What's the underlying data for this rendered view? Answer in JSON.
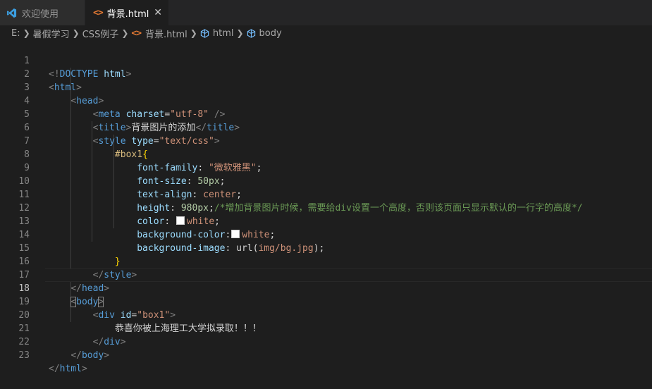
{
  "tabs": [
    {
      "label": "欢迎使用",
      "icon": "vscode-logo-icon"
    },
    {
      "label": "背景.html",
      "icon": "html-file-icon",
      "close": "✕"
    }
  ],
  "breadcrumb": {
    "drive": "E:",
    "folder1": "暑假学习",
    "folder2": "CSS例子",
    "file": "背景.html",
    "symbol1": "html",
    "symbol2": "body"
  },
  "editor": {
    "line_numbers": [
      "1",
      "2",
      "3",
      "4",
      "5",
      "6",
      "7",
      "8",
      "9",
      "10",
      "11",
      "12",
      "13",
      "14",
      "15",
      "16",
      "17",
      "18",
      "19",
      "20",
      "21",
      "22",
      "23"
    ],
    "code": {
      "l1": {
        "open": "<!",
        "kw": "DOCTYPE",
        "name": "html",
        "close": ">"
      },
      "l2": {
        "open": "<",
        "tag": "html",
        "close": ">"
      },
      "l3": {
        "open": "<",
        "tag": "head",
        "close": ">"
      },
      "l4": {
        "open": "<",
        "tag": "meta",
        "attr": "charset",
        "eq": "=",
        "val": "\"utf-8\"",
        "close": " />"
      },
      "l5": {
        "open": "<",
        "tag": "title",
        "close": ">",
        "text": "背景图片的添加",
        "open2": "</",
        "tag2": "title",
        "close2": ">"
      },
      "l6": {
        "open": "<",
        "tag": "style",
        "attr": "type",
        "eq": "=",
        "val": "\"text/css\"",
        "close": ">"
      },
      "l7": {
        "selector": "#box1",
        "brace": "{"
      },
      "l8": {
        "prop": "font-family",
        "colon": ": ",
        "val": "\"微软雅黑\"",
        "semi": ";"
      },
      "l9": {
        "prop": "font-size",
        "colon": ": ",
        "val": "50px",
        "semi": ";"
      },
      "l10": {
        "prop": "text-align",
        "colon": ": ",
        "val": "center",
        "semi": ";"
      },
      "l11": {
        "prop": "height",
        "colon": ": ",
        "val": "980px",
        "semi": ";",
        "comment": "/*增加背景图片时候，需要给div设置一个高度，否则该页面只显示默认的一行字的高度*/"
      },
      "l12": {
        "prop": "color",
        "colon": ": ",
        "val": "white",
        "semi": ";"
      },
      "l13": {
        "prop": "background-color",
        "colon": ":",
        "val": "white",
        "semi": ";"
      },
      "l14": {
        "prop": "background-image",
        "colon": ": ",
        "fn": "url(",
        "val": "img/bg.jpg",
        "fnclose": ")",
        "semi": ";"
      },
      "l15": {
        "brace": "}"
      },
      "l16": {
        "open": "</",
        "tag": "style",
        "close": ">"
      },
      "l17": {
        "open": "</",
        "tag": "head",
        "close": ">"
      },
      "l18": {
        "open": "<",
        "tag": "body",
        "close": ">"
      },
      "l19": {
        "open": "<",
        "tag": "div",
        "attr": "id",
        "eq": "=",
        "val": "\"box1\"",
        "close": ">"
      },
      "l20": {
        "text": "恭喜你被上海理工大学拟录取！！！"
      },
      "l21": {
        "open": "</",
        "tag": "div",
        "close": ">"
      },
      "l22": {
        "open": "</",
        "tag": "body",
        "close": ">"
      },
      "l23": {
        "open": "</",
        "tag": "html",
        "close": ">"
      }
    }
  },
  "colors": {
    "background": "#1e1e1e",
    "tag": "#569cd6",
    "attribute": "#9cdcfe",
    "string": "#ce9178",
    "selector": "#d7ba7d",
    "number": "#b5cea8",
    "comment": "#6a9955",
    "bracket": "#808080"
  }
}
